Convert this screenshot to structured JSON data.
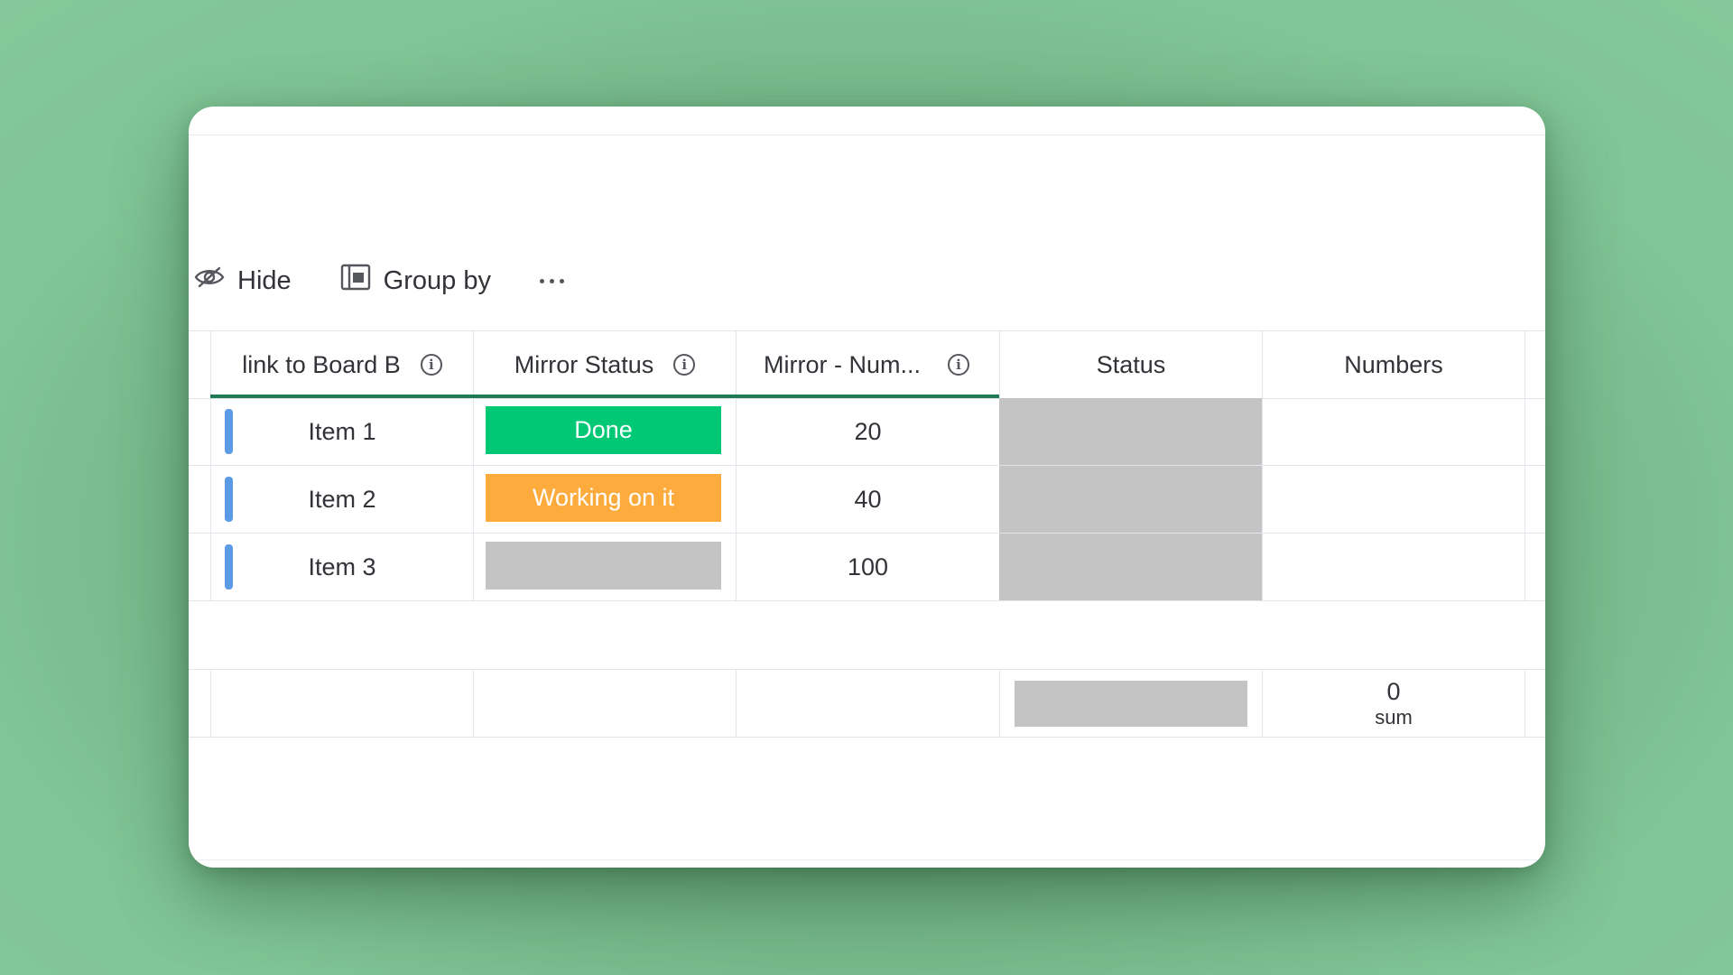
{
  "toolbar": {
    "hide_label": "Hide",
    "group_by_label": "Group by",
    "hide_icon": "eye-slash-icon",
    "group_by_icon": "group-by-icon",
    "more_icon": "more-horizontal-icon"
  },
  "columns": [
    {
      "label": "link to Board B",
      "info": true
    },
    {
      "label": "Mirror Status",
      "info": true
    },
    {
      "label": "Mirror - Num...",
      "info": true
    },
    {
      "label": "Status",
      "info": false
    },
    {
      "label": "Numbers",
      "info": false
    }
  ],
  "rows": [
    {
      "item": "Item 1",
      "mirror_status": "Done",
      "mirror_status_color": "#00c875",
      "mirror_number": "20"
    },
    {
      "item": "Item 2",
      "mirror_status": "Working on it",
      "mirror_status_color": "#fdab3d",
      "mirror_number": "40"
    },
    {
      "item": "Item 3",
      "mirror_status": "",
      "mirror_status_color": "#c4c4c4",
      "mirror_number": "100"
    }
  ],
  "footer": {
    "numbers_sum": "0",
    "numbers_sum_label": "sum"
  },
  "colors": {
    "header_underline": "#1f7a55",
    "item_bar": "#5b9be6",
    "empty_status": "#c4c4c4"
  }
}
